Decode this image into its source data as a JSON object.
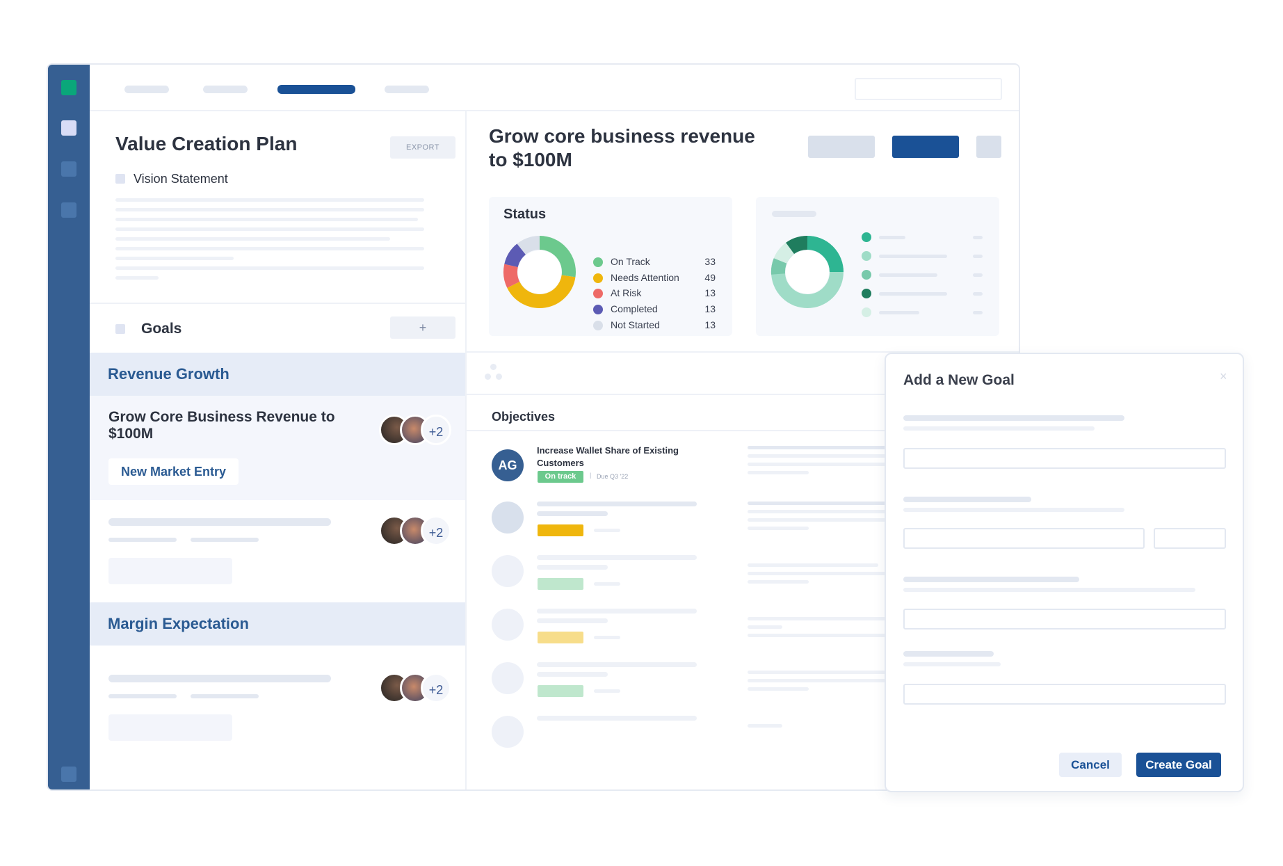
{
  "plan": {
    "title": "Value Creation Plan",
    "export_label": "EXPORT",
    "vision_label": "Vision Statement",
    "goals_label": "Goals",
    "add_label": "+"
  },
  "groups": [
    {
      "name": "Revenue Growth"
    },
    {
      "name": "Margin Expectation"
    }
  ],
  "goal": {
    "title": "Grow Core Business Revenue to $100M",
    "tag": "New Market Entry",
    "more_count": "+2"
  },
  "detail": {
    "title": "Grow core business revenue to $100M",
    "status_title": "Status",
    "status_items": [
      {
        "label": "On Track",
        "value": "33",
        "color": "#6cc98d"
      },
      {
        "label": "Needs Attention",
        "value": "49",
        "color": "#efb60d"
      },
      {
        "label": "At Risk",
        "value": "13",
        "color": "#ee6a67"
      },
      {
        "label": "Completed",
        "value": "13",
        "color": "#5c5bb4"
      },
      {
        "label": "Not Started",
        "value": "13",
        "color": "#d9dfe9"
      }
    ]
  },
  "objectives": {
    "title": "Objectives",
    "first": {
      "initials": "AG",
      "title": "Increase Wallet Share of Existing Customers",
      "status": "On track",
      "due": "Due Q3 '22"
    }
  },
  "modal": {
    "title": "Add a New Goal",
    "cancel_label": "Cancel",
    "create_label": "Create Goal"
  },
  "colors": {
    "sidebar": "#365f92",
    "primary": "#1a5196",
    "accent_green": "#0aa77a"
  }
}
